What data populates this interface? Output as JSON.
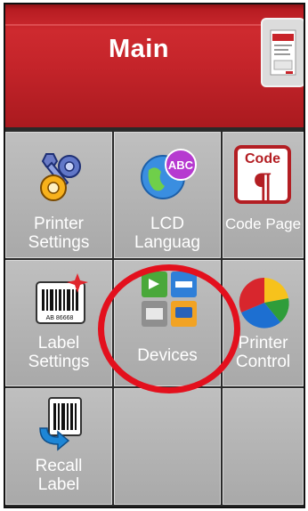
{
  "header": {
    "title": "Main"
  },
  "tiles": [
    {
      "label": "Printer\nSettings",
      "icon": "printer-settings-gears-icon"
    },
    {
      "label": "LCD\nLanguag",
      "icon": "globe-abc-icon"
    },
    {
      "label": "Code Page",
      "icon": "code-pilcrow-icon"
    },
    {
      "label": "Label\nSettings",
      "icon": "barcode-label-icon"
    },
    {
      "label": "Devices",
      "icon": "devices-icon"
    },
    {
      "label": "Printer\nControl",
      "icon": "pie-chart-icon"
    },
    {
      "label": "Recall\nLabel",
      "icon": "recall-barcode-icon"
    },
    {
      "label": "",
      "icon": ""
    },
    {
      "label": "",
      "icon": ""
    }
  ],
  "code_icon_text": "Code",
  "barcode_icon_text": "AB 86668",
  "highlight": {
    "color": "#e3101d",
    "target": "Devices"
  }
}
